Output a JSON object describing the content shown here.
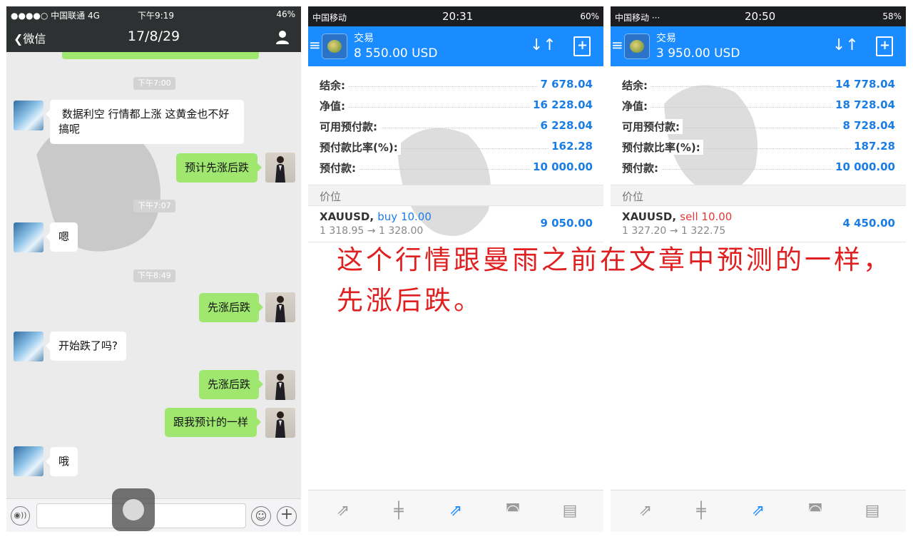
{
  "wechat": {
    "status": {
      "carrier": "●●●●○ 中国联通  4G",
      "time": "下午9:19",
      "battery": "46%"
    },
    "nav": {
      "back_label": "微信",
      "title": "17/8/29"
    },
    "timestamps": [
      "下午7:00",
      "下午7:07",
      "下午8:49"
    ],
    "messages": [
      {
        "from": "in",
        "text": " 数据利空 行情都上涨 这黄金也不好\n搞呢"
      },
      {
        "from": "out",
        "text": "预计先涨后跌"
      },
      {
        "from": "in",
        "text": "嗯"
      },
      {
        "from": "out",
        "text": "先涨后跌"
      },
      {
        "from": "in",
        "text": "开始跌了吗?"
      },
      {
        "from": "out",
        "text": "先涨后跌"
      },
      {
        "from": "out",
        "text": "跟我预计的一样"
      },
      {
        "from": "in",
        "text": "哦"
      }
    ],
    "input": {
      "placeholder": ""
    }
  },
  "panels": [
    {
      "status": {
        "carrier": "中国移动",
        "time": "20:31",
        "battery": "60%"
      },
      "header": {
        "title": "交易",
        "profit": "8 550.00 USD"
      },
      "rows": [
        {
          "label": "结余:",
          "value": "7 678.04"
        },
        {
          "label": "净值:",
          "value": "16 228.04"
        },
        {
          "label": "可用预付款:",
          "value": "6 228.04"
        },
        {
          "label": "预付款比率(%):",
          "value": "162.28"
        },
        {
          "label": "预付款:",
          "value": "10 000.00"
        }
      ],
      "section": "价位",
      "position": {
        "symbol": "XAUUSD,",
        "direction": "buy 10.00",
        "prices": "1 318.95 → 1 328.00",
        "profit": "9 050.00"
      }
    },
    {
      "status": {
        "carrier": "中国移动 ···",
        "time": "20:50",
        "battery": "58%"
      },
      "header": {
        "title": "交易",
        "profit": "3 950.00 USD"
      },
      "rows": [
        {
          "label": "结余:",
          "value": "14 778.04"
        },
        {
          "label": "净值:",
          "value": "18 728.04"
        },
        {
          "label": "可用预付款:",
          "value": "8 728.04"
        },
        {
          "label": "预付款比率(%):",
          "value": "187.28"
        },
        {
          "label": "预付款:",
          "value": "10 000.00"
        }
      ],
      "section": "价位",
      "position": {
        "symbol": "XAUUSD,",
        "direction": "sell 10.00",
        "prices": "1 327.20 → 1 322.75",
        "profit": "4 450.00"
      }
    }
  ],
  "tabbar_icons": [
    "quotes-icon",
    "chart-icon",
    "trade-icon",
    "history-icon",
    "news-icon"
  ],
  "caption": "这个行情跟曼雨之前在文章中预测的一样，先涨后跌。",
  "colors": {
    "wechat_bar": "#2e3132",
    "bubble_out": "#9fe76f",
    "mt4_blue": "#1a8cff",
    "value_blue": "#1a7de6",
    "sell_red": "#e03a3a",
    "caption_red": "#e02020"
  }
}
